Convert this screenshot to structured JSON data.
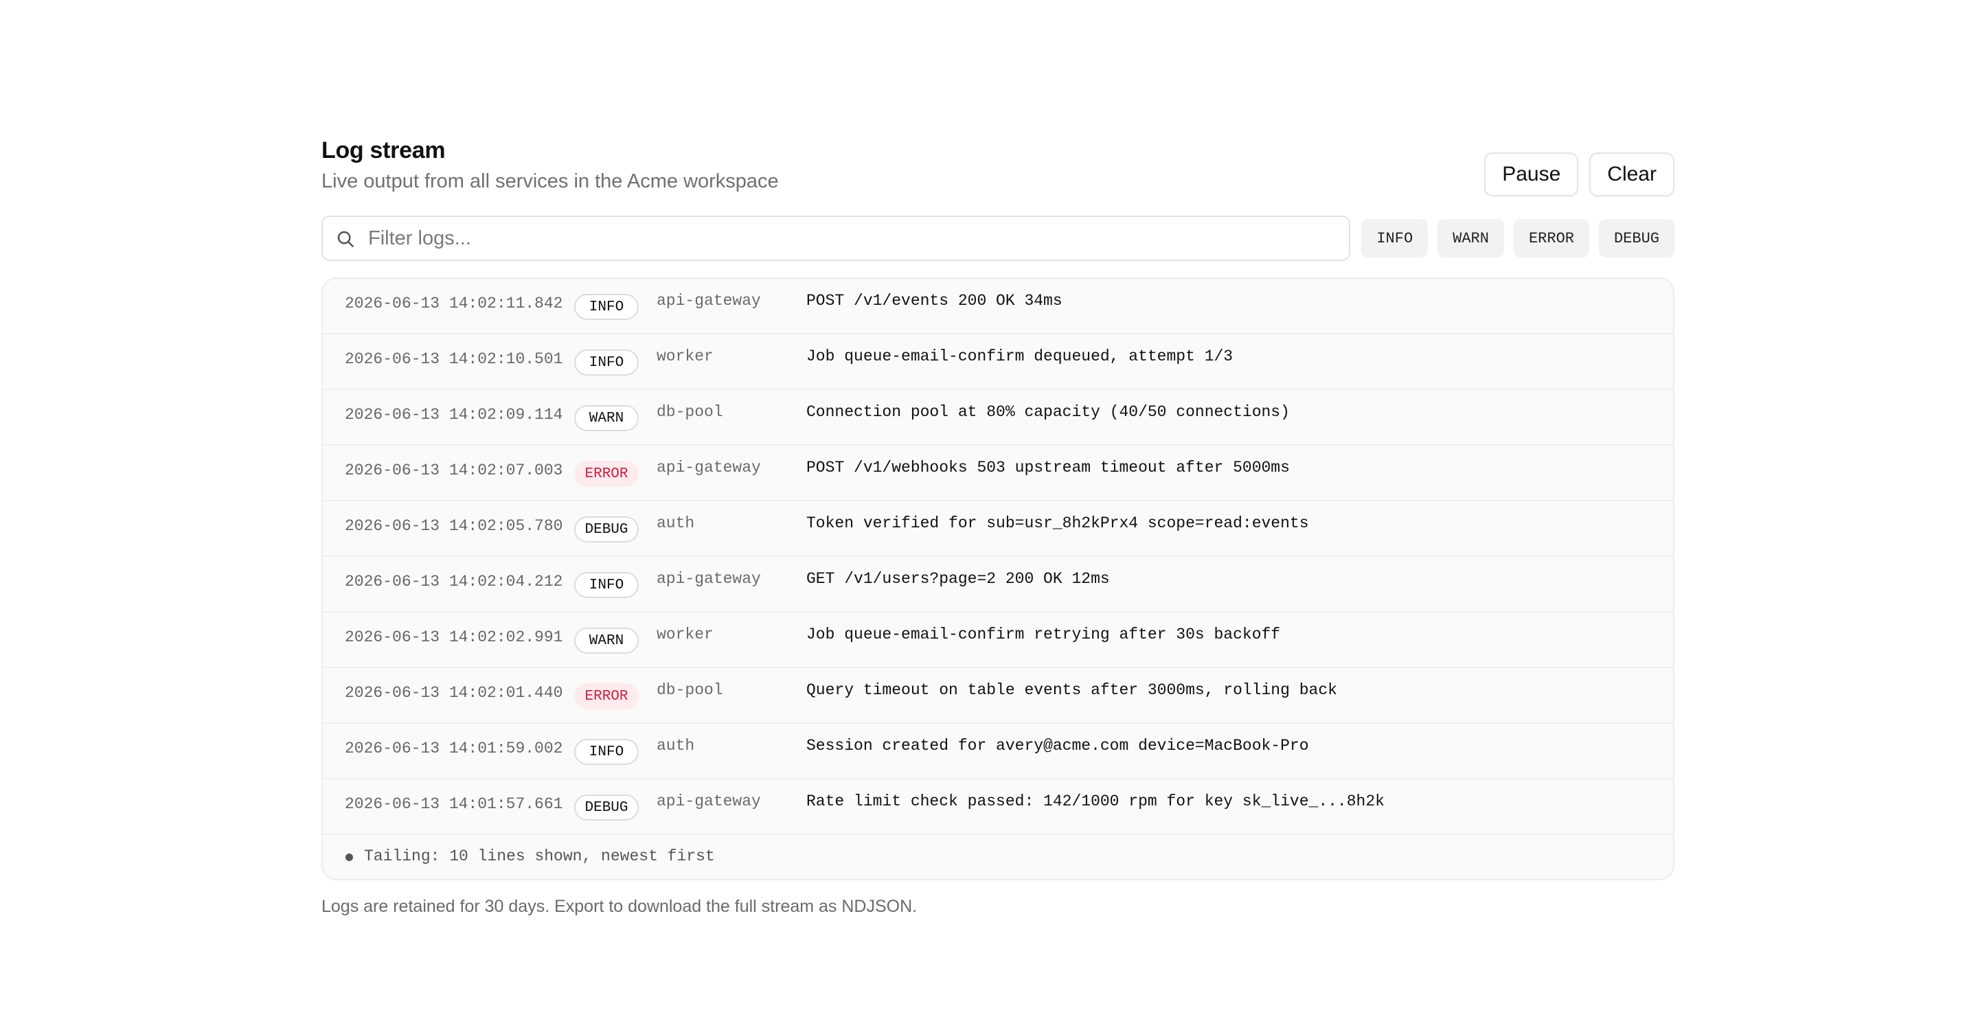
{
  "header": {
    "title": "Log stream",
    "subtitle": "Live output from all services in the Acme workspace"
  },
  "actions": {
    "pause_label": "Pause",
    "clear_label": "Clear"
  },
  "search": {
    "placeholder": "Filter logs...",
    "value": "",
    "icon": "search-icon"
  },
  "level_filters": [
    "INFO",
    "WARN",
    "ERROR",
    "DEBUG"
  ],
  "colors": {
    "error_text": "#d02040",
    "error_bg": "#fdebee"
  },
  "logs": [
    {
      "timestamp": "2026-06-13 14:02:11.842",
      "level": "INFO",
      "service": "api-gateway",
      "message": "POST /v1/events 200 OK 34ms"
    },
    {
      "timestamp": "2026-06-13 14:02:10.501",
      "level": "INFO",
      "service": "worker",
      "message": "Job queue-email-confirm dequeued, attempt 1/3"
    },
    {
      "timestamp": "2026-06-13 14:02:09.114",
      "level": "WARN",
      "service": "db-pool",
      "message": "Connection pool at 80% capacity (40/50 connections)"
    },
    {
      "timestamp": "2026-06-13 14:02:07.003",
      "level": "ERROR",
      "service": "api-gateway",
      "message": "POST /v1/webhooks 503 upstream timeout after 5000ms"
    },
    {
      "timestamp": "2026-06-13 14:02:05.780",
      "level": "DEBUG",
      "service": "auth",
      "message": "Token verified for sub=usr_8h2kPrx4 scope=read:events"
    },
    {
      "timestamp": "2026-06-13 14:02:04.212",
      "level": "INFO",
      "service": "api-gateway",
      "message": "GET /v1/users?page=2 200 OK 12ms"
    },
    {
      "timestamp": "2026-06-13 14:02:02.991",
      "level": "WARN",
      "service": "worker",
      "message": "Job queue-email-confirm retrying after 30s backoff"
    },
    {
      "timestamp": "2026-06-13 14:02:01.440",
      "level": "ERROR",
      "service": "db-pool",
      "message": "Query timeout on table events after 3000ms, rolling back"
    },
    {
      "timestamp": "2026-06-13 14:01:59.002",
      "level": "INFO",
      "service": "auth",
      "message": "Session created for avery@acme.com device=MacBook-Pro"
    },
    {
      "timestamp": "2026-06-13 14:01:57.661",
      "level": "DEBUG",
      "service": "api-gateway",
      "message": "Rate limit check passed: 142/1000 rpm for key sk_live_...8h2k"
    }
  ],
  "tail_status": "Tailing: 10 lines shown, newest first",
  "footnote": "Logs are retained for 30 days. Export to download the full stream as NDJSON."
}
